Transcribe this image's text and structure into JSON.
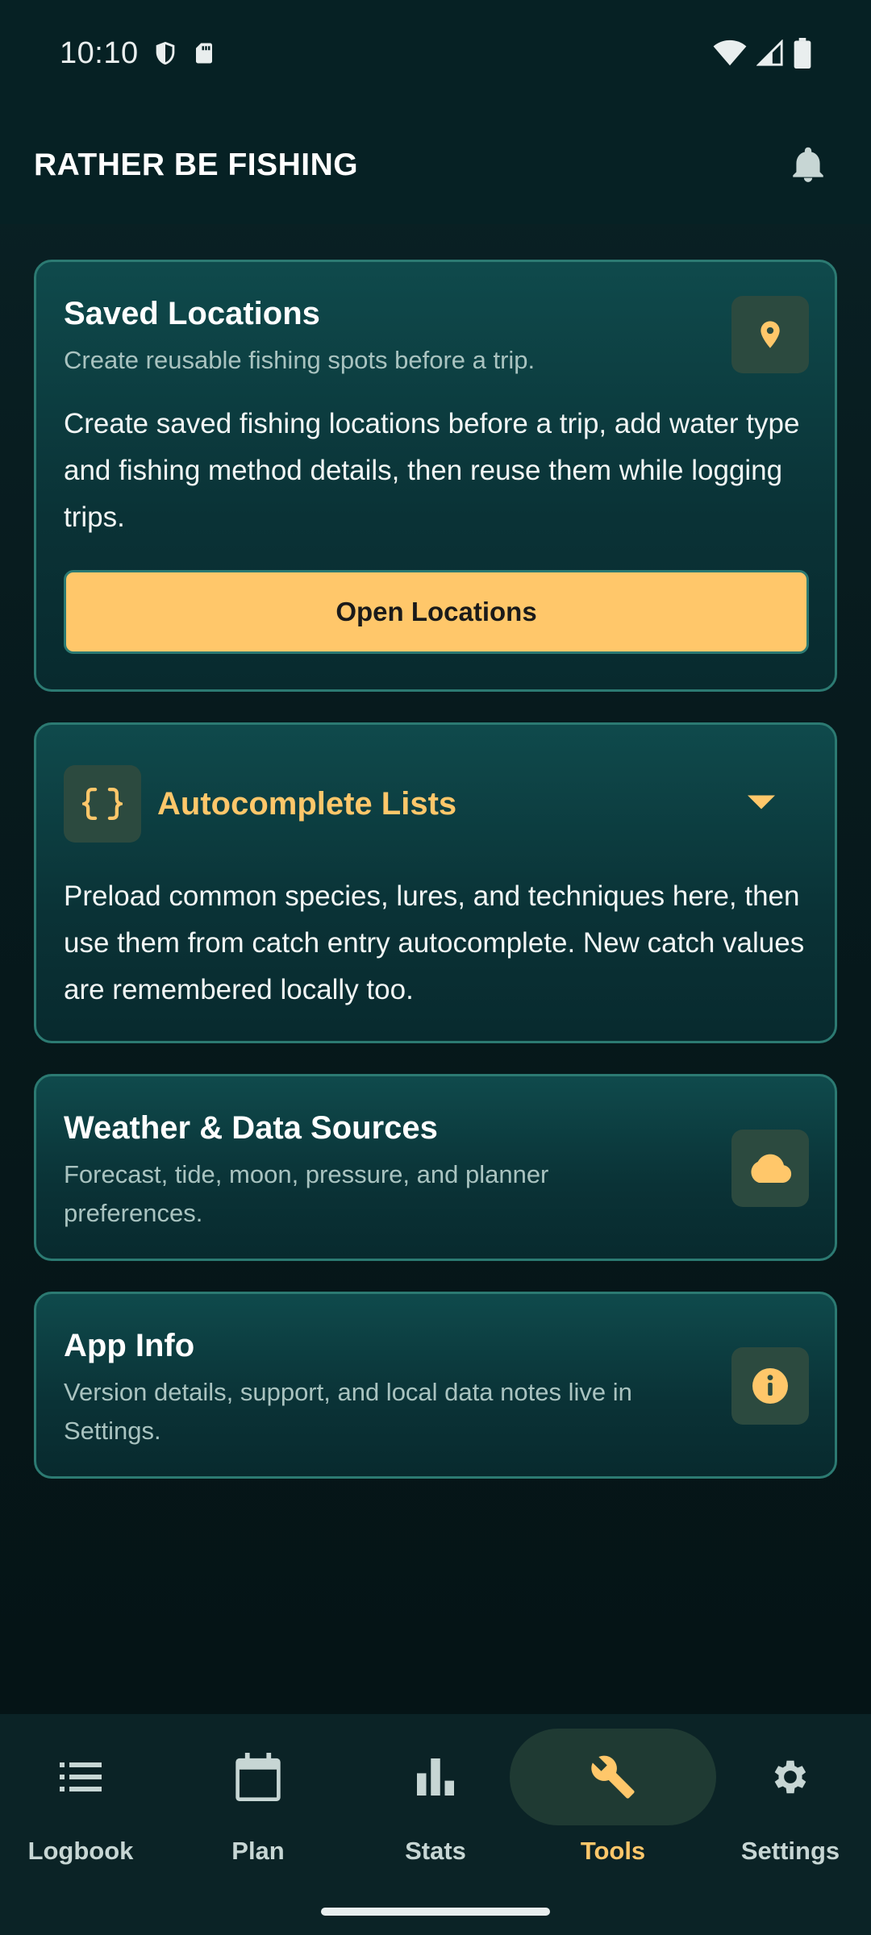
{
  "status": {
    "time": "10:10"
  },
  "app_bar": {
    "title": "RATHER BE FISHING"
  },
  "saved_locations": {
    "title": "Saved Locations",
    "subtitle": "Create reusable fishing spots before a trip.",
    "body": "Create saved fishing locations before a trip, add water type and fishing method details, then reuse them while logging trips.",
    "button_label": "Open Locations",
    "icon": "location-pin-icon"
  },
  "autocomplete": {
    "title": "Autocomplete Lists",
    "body": "Preload common species, lures, and techniques here, then use them from catch entry autocomplete. New catch values are remembered locally too.",
    "icon": "curly-braces-icon",
    "expanded": true
  },
  "weather": {
    "title": "Weather & Data Sources",
    "subtitle": "Forecast, tide, moon, pressure, and planner preferences.",
    "icon": "cloud-icon"
  },
  "app_info": {
    "title": "App Info",
    "subtitle": "Version details, support, and local data notes live in Settings.",
    "icon": "info-icon"
  },
  "nav": {
    "items": [
      {
        "label": "Logbook",
        "icon": "list-icon",
        "active": false
      },
      {
        "label": "Plan",
        "icon": "calendar-icon",
        "active": false
      },
      {
        "label": "Stats",
        "icon": "bar-chart-icon",
        "active": false
      },
      {
        "label": "Tools",
        "icon": "wrench-icon",
        "active": true
      },
      {
        "label": "Settings",
        "icon": "gear-icon",
        "active": false
      }
    ]
  },
  "colors": {
    "accent": "#ffc76a",
    "background": "#071a1d",
    "card_border": "#2c7a72"
  }
}
